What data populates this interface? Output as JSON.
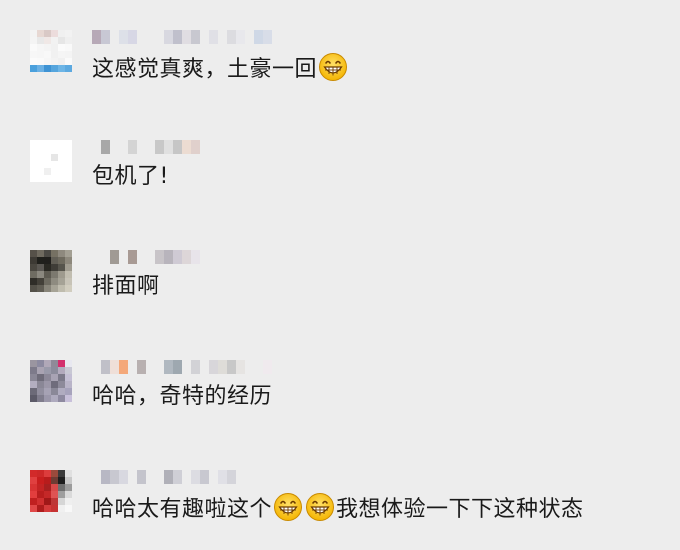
{
  "comments": [
    {
      "text": "这感觉真爽，土豪一回",
      "emoji_after": 1,
      "emoji_name": "grinning-face-icon",
      "avatar_colors": [
        "#f3f3f3",
        "#e7d8d3",
        "#d9c9c6",
        "#ecdcdc",
        "#f0f0f0",
        "#f2f2f2",
        "#f4f4f4",
        "#e8e8e8",
        "#f0e8e6",
        "#f2f2f2",
        "#e6e6e6",
        "#efefef",
        "#fafafa",
        "#f6f6f6",
        "#f4f4f4",
        "#f1f1f1",
        "#fbfbfb",
        "#f9f9f9",
        "#f7f7f7",
        "#f6f6f6",
        "#f8f8f8",
        "#f1f1f1",
        "#f5f5f5",
        "#f4f4f4",
        "#fbfbfb",
        "#fafafa",
        "#f6f6f6",
        "#f3f3f3",
        "#f0f0f0",
        "#fafafa",
        "#4aa0dc",
        "#6ab0e4",
        "#3e93d4",
        "#55a5dd",
        "#6db5e6",
        "#5ca9e0"
      ],
      "nick_colors": [
        "#b7a9b7",
        "#c8c8d4",
        "#ededed",
        "#dde0e8",
        "#d7d7e5",
        "#ededed",
        "#ededed",
        "#ededed",
        "#d8d8e0",
        "#c0c0cc",
        "#e0dde2",
        "#c8c8d0",
        "#ededed",
        "#e0e0e6",
        "#ededed",
        "#dcdce0",
        "#e8e8ec",
        "#ededed",
        "#cfd8e6",
        "#d8dde8"
      ]
    },
    {
      "text": "包机了!",
      "emoji_after": 0,
      "avatar_colors": [
        "#ffffff",
        "#ffffff",
        "#ffffff",
        "#ffffff",
        "#ffffff",
        "#ffffff",
        "#ffffff",
        "#ffffff",
        "#ffffff",
        "#ffffff",
        "#ffffff",
        "#ffffff",
        "#ffffff",
        "#ffffff",
        "#ffffff",
        "#e6e6e6",
        "#ffffff",
        "#ffffff",
        "#ffffff",
        "#ffffff",
        "#ffffff",
        "#ffffff",
        "#ffffff",
        "#ffffff",
        "#ffffff",
        "#ffffff",
        "#f0f0f0",
        "#ffffff",
        "#ffffff",
        "#ffffff",
        "#ffffff",
        "#ffffff",
        "#ffffff",
        "#ffffff",
        "#ffffff",
        "#ffffff"
      ],
      "nick_colors": [
        "#ededed",
        "#a8a8a8",
        "#ededed",
        "#ededed",
        "#d4d4d4",
        "#ededed",
        "#ededed",
        "#c8c8c8",
        "#e0e0e0",
        "#c6c6c6",
        "#ecdcd2",
        "#e0d0cc"
      ]
    },
    {
      "text": "排面啊",
      "emoji_after": 0,
      "avatar_colors": [
        "#565149",
        "#6f6a5f",
        "#4b4944",
        "#767163",
        "#8e897e",
        "#a39f93",
        "#3d3a34",
        "#20201c",
        "#201f1c",
        "#615e55",
        "#6e6a5e",
        "#8d887c",
        "#4a4740",
        "#5b5853",
        "#2a2923",
        "#3f3d37",
        "#56544c",
        "#a09c90",
        "#6f6c62",
        "#8b887f",
        "#5d5a51",
        "#7c796f",
        "#9e9a8e",
        "#c1bdb0",
        "#2f2d28",
        "#434039",
        "#6d6a60",
        "#8e8b80",
        "#a5a296",
        "#c7c3b7",
        "#545149",
        "#605d54",
        "#88857a",
        "#a6a396",
        "#bfbcae",
        "#d1cdbf"
      ],
      "nick_colors": [
        "#ededed",
        "#ededed",
        "#a09a94",
        "#ededed",
        "#a89a94",
        "#ededed",
        "#ededed",
        "#c8c4c8",
        "#b8b4bc",
        "#cfcad4",
        "#ddd6d8",
        "#e8e4ea"
      ]
    },
    {
      "text": "哈哈，奇特的经历",
      "emoji_after": 0,
      "avatar_colors": [
        "#9a95a0",
        "#8c8aa0",
        "#b0a8b8",
        "#8f8a98",
        "#d32f6e",
        "#e8e8f0",
        "#7d7a8a",
        "#a9a3b2",
        "#9a9aaa",
        "#8c8c9c",
        "#b2aabd",
        "#c8c8d4",
        "#8a8796",
        "#6f6c7a",
        "#8c8898",
        "#a8a3b4",
        "#7c7a8a",
        "#c4bfd4",
        "#b3aec0",
        "#8a8796",
        "#9c97a8",
        "#6f6c7c",
        "#8d8a9a",
        "#b9b4c8",
        "#6c6a78",
        "#918e9e",
        "#a6a2b4",
        "#8a8898",
        "#b0acc0",
        "#a7a3bc",
        "#5c5a68",
        "#7f7c8c",
        "#9b97aa",
        "#aeaabe",
        "#8e8aa0",
        "#c8c0da"
      ],
      "nick_colors": [
        "#ededed",
        "#c0c0c8",
        "#efdfd8",
        "#f4a87a",
        "#ededed",
        "#b8b0b0",
        "#ededed",
        "#ededed",
        "#b0b8c0",
        "#9ea8b0",
        "#ededed",
        "#d2d2d6",
        "#ededed",
        "#d8d6da",
        "#dedcd8",
        "#c8c8c8",
        "#e6e4e2",
        "#ededed",
        "#ededed",
        "#f0eaee"
      ]
    },
    {
      "text": "哈哈太有趣啦这个",
      "tail": "我想体验一下下这种状态",
      "emoji_after": 2,
      "avatar_colors": [
        "#d22a2a",
        "#cc2828",
        "#dc3c3c",
        "#9a4a3c",
        "#3a3a3a",
        "#e0e0e0",
        "#e04040",
        "#c81e1e",
        "#b81c1c",
        "#6e3c34",
        "#1e1e1e",
        "#c8c8c8",
        "#d83434",
        "#c42424",
        "#a82020",
        "#d84a4a",
        "#6e6e6e",
        "#9c9c9c",
        "#e23e3e",
        "#b81e1e",
        "#c42828",
        "#de5454",
        "#9e9e9e",
        "#dadada",
        "#c02020",
        "#d03030",
        "#a01818",
        "#be3636",
        "#d6d6d6",
        "#efefef",
        "#e04848",
        "#ae1c1c",
        "#d43a3a",
        "#c63232",
        "#f0f0f0",
        "#f8f8f8"
      ],
      "nick_colors": [
        "#ededed",
        "#b8b8c4",
        "#c8c8d0",
        "#d8d8e0",
        "#ededed",
        "#c4c4cc",
        "#ededed",
        "#ededed",
        "#b0b0b8",
        "#cfcfd6",
        "#ededed",
        "#dcdce2",
        "#c8c8d0",
        "#ededed",
        "#e0e0e6",
        "#d4d4da"
      ]
    }
  ]
}
